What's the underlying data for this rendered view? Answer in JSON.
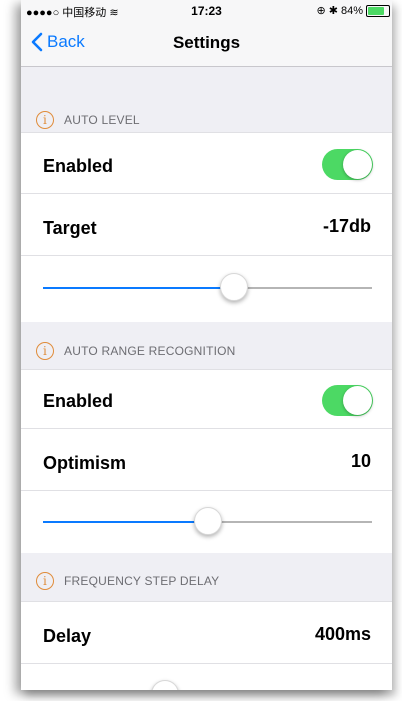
{
  "status_bar": {
    "carrier": "●●●●○ 中国移动 ",
    "wifi_icon": "wifi-icon",
    "time": "17:23",
    "battery_text": "84%",
    "battery_level": 0.84
  },
  "nav": {
    "back_label": "Back",
    "title": "Settings"
  },
  "sections": {
    "auto_level": {
      "header": "AUTO LEVEL",
      "enabled_label": "Enabled",
      "enabled": true,
      "target_label": "Target",
      "target_value": "-17db",
      "slider_fraction": 0.58
    },
    "auto_range": {
      "header": "AUTO RANGE RECOGNITION",
      "enabled_label": "Enabled",
      "enabled": true,
      "optimism_label": "Optimism",
      "optimism_value": "10",
      "slider_fraction": 0.5
    },
    "frequency_step": {
      "header": "FREQUENCY STEP DELAY",
      "delay_label": "Delay",
      "delay_value": "400ms",
      "slider_fraction": 0.37
    }
  },
  "colors": {
    "accent": "#0a7aff",
    "toggle_on": "#4cd964",
    "info": "#e08c3a"
  }
}
